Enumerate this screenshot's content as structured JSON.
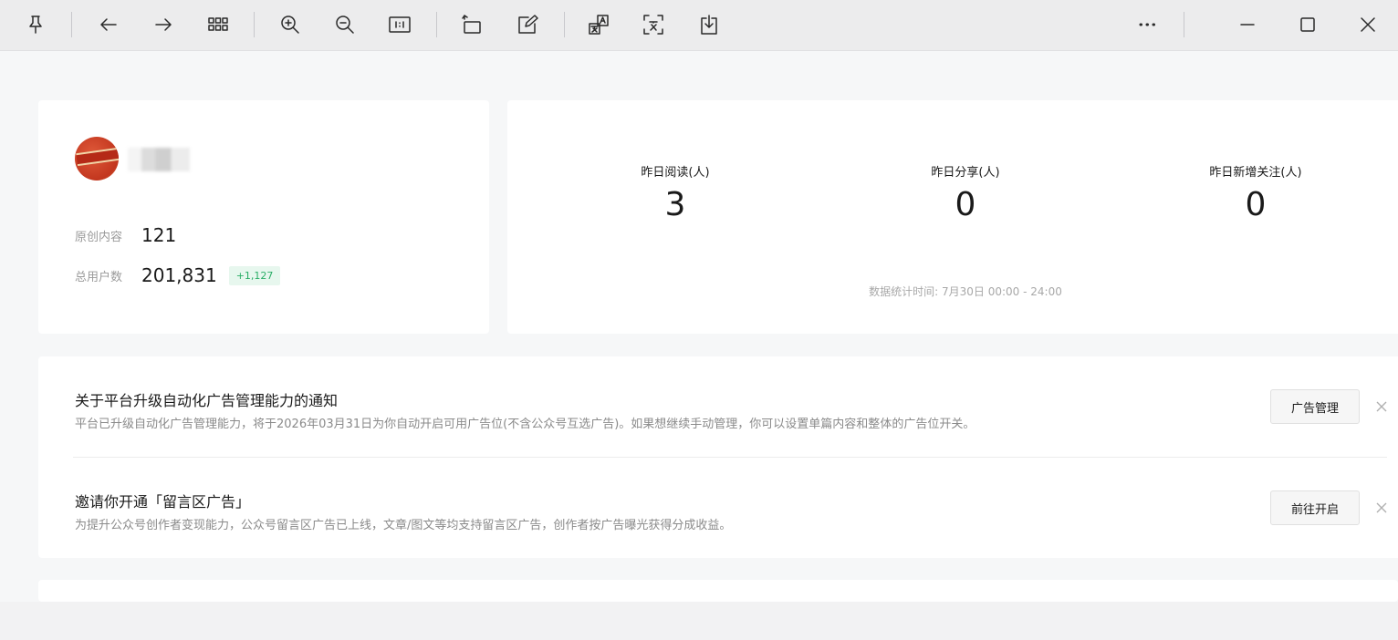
{
  "toolbar": {
    "buttons": [
      {
        "name": "pin-button",
        "icon": "pin-icon"
      },
      {
        "name": "back-button",
        "icon": "arrow-left-icon"
      },
      {
        "name": "forward-button",
        "icon": "arrow-right-icon"
      },
      {
        "name": "grid-view-button",
        "icon": "grid-icon"
      },
      {
        "name": "zoom-in-button",
        "icon": "zoom-in-icon"
      },
      {
        "name": "zoom-out-button",
        "icon": "zoom-out-icon"
      },
      {
        "name": "actual-size-button",
        "icon": "actual-size-icon"
      },
      {
        "name": "rotate-button",
        "icon": "rotate-icon"
      },
      {
        "name": "edit-button",
        "icon": "edit-icon"
      },
      {
        "name": "translate-button",
        "icon": "translate-icon"
      },
      {
        "name": "extract-text-button",
        "icon": "extract-text-icon"
      },
      {
        "name": "save-button",
        "icon": "download-icon"
      },
      {
        "name": "more-button",
        "icon": "more-icon"
      },
      {
        "name": "minimize-button",
        "icon": "minimize-icon"
      },
      {
        "name": "maximize-button",
        "icon": "maximize-icon"
      },
      {
        "name": "close-button",
        "icon": "close-icon"
      }
    ]
  },
  "profile": {
    "original_label": "原创内容",
    "original_value": "121",
    "users_label": "总用户数",
    "users_value": "201,831",
    "users_delta": "+1,127"
  },
  "metrics": {
    "items": [
      {
        "label": "昨日阅读(人)",
        "value": "3"
      },
      {
        "label": "昨日分享(人)",
        "value": "0"
      },
      {
        "label": "昨日新增关注(人)",
        "value": "0"
      }
    ],
    "footnote": "数据统计时间: 7月30日 00:00 - 24:00"
  },
  "notices": [
    {
      "title": "关于平台升级自动化广告管理能力的通知",
      "desc": "平台已升级自动化广告管理能力，将于2026年03月31日为你自动开启可用广告位(不含公众号互选广告)。如果想继续手动管理，你可以设置单篇内容和整体的广告位开关。",
      "button": "广告管理"
    },
    {
      "title": "邀请你开通「留言区广告」",
      "desc": "为提升公众号创作者变现能力，公众号留言区广告已上线，文章/图文等均支持留言区广告，创作者按广告曝光获得分成收益。",
      "button": "前往开启"
    }
  ],
  "colors": {
    "delta_green": "#2aae67",
    "toolbar_bg": "#ececed",
    "page_bg": "#f6f7f8"
  }
}
